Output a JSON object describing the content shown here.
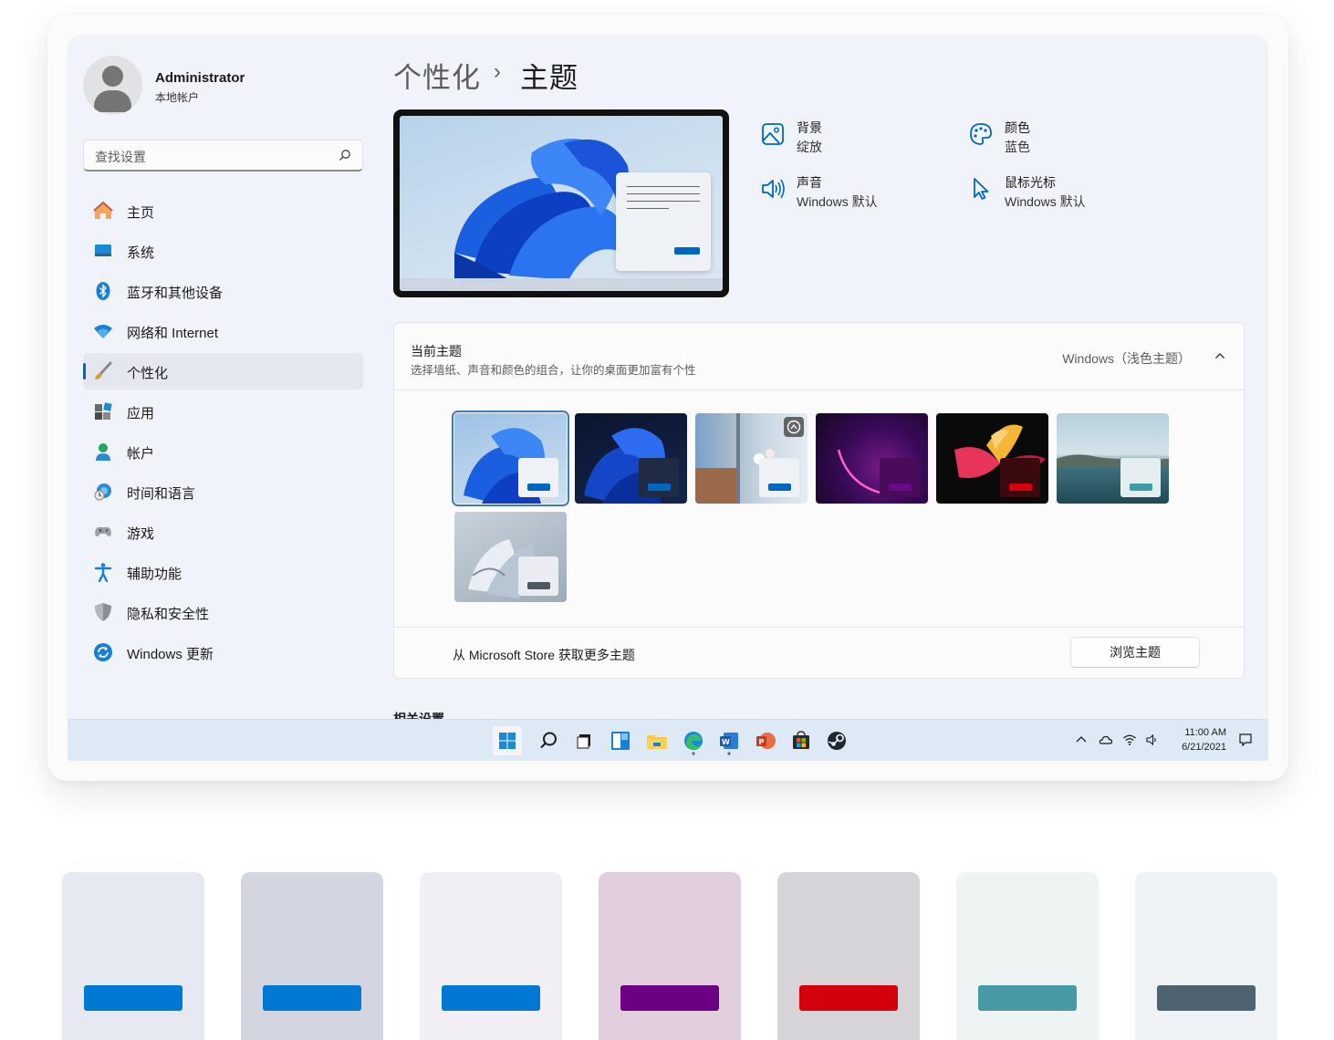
{
  "user": {
    "name": "Administrator",
    "account_type": "本地帐户"
  },
  "search": {
    "placeholder": "查找设置"
  },
  "nav": {
    "items": [
      {
        "label": "主页",
        "icon": "home-icon"
      },
      {
        "label": "系统",
        "icon": "system-icon"
      },
      {
        "label": "蓝牙和其他设备",
        "icon": "bluetooth-icon"
      },
      {
        "label": "网络和 Internet",
        "icon": "wifi-icon"
      },
      {
        "label": "个性化",
        "icon": "brush-icon",
        "active": true
      },
      {
        "label": "应用",
        "icon": "apps-icon"
      },
      {
        "label": "帐户",
        "icon": "account-icon"
      },
      {
        "label": "时间和语言",
        "icon": "time-language-icon"
      },
      {
        "label": "游戏",
        "icon": "gaming-icon"
      },
      {
        "label": "辅助功能",
        "icon": "accessibility-icon"
      },
      {
        "label": "隐私和安全性",
        "icon": "shield-icon"
      },
      {
        "label": "Windows 更新",
        "icon": "update-icon"
      }
    ]
  },
  "breadcrumb": {
    "parent": "个性化",
    "separator": "›",
    "current": "主题"
  },
  "quick_settings": {
    "background": {
      "title": "背景",
      "value": "绽放",
      "icon": "picture-icon"
    },
    "color": {
      "title": "颜色",
      "value": "蓝色",
      "icon": "palette-icon"
    },
    "sound": {
      "title": "声音",
      "value": "Windows 默认",
      "icon": "speaker-icon"
    },
    "cursor": {
      "title": "鼠标光标",
      "value": "Windows 默认",
      "icon": "cursor-icon"
    }
  },
  "current_theme": {
    "title": "当前主题",
    "description": "选择墙纸、声音和颜色的组合，让你的桌面更加富有个性",
    "value": "Windows（浅色主题）",
    "themes": [
      {
        "name": "light-bloom",
        "selected": true,
        "accent": "#0067c0"
      },
      {
        "name": "dark-bloom",
        "selected": false,
        "accent": "#0067c0"
      },
      {
        "name": "spotlight",
        "selected": false,
        "accent": "#0067c0"
      },
      {
        "name": "glow",
        "selected": false,
        "accent": "#6a0a8a"
      },
      {
        "name": "captured-motion",
        "selected": false,
        "accent": "#d40010"
      },
      {
        "name": "sunrise-lake",
        "selected": false,
        "accent": "#3f9aa7"
      },
      {
        "name": "flow",
        "selected": false,
        "accent": "#4a5964"
      }
    ]
  },
  "store": {
    "text": "从 Microsoft Store 获取更多主题",
    "button": "浏览主题"
  },
  "related": {
    "title": "相关设置"
  },
  "taskbar": {
    "apps": [
      "start-icon",
      "search-icon",
      "task-view-icon",
      "widgets-icon",
      "file-explorer-icon",
      "edge-icon",
      "word-icon",
      "powerpoint-icon",
      "store-icon",
      "steam-icon"
    ],
    "time": "11:00 AM",
    "date": "6/21/2021"
  },
  "swatches": [
    {
      "bg": "#e6e9f1",
      "accent": "#0078d4"
    },
    {
      "bg": "#d3d6e1",
      "accent": "#0078d4"
    },
    {
      "bg": "#f1eff4",
      "accent": "#0078d4"
    },
    {
      "bg": "#e2cfdd",
      "accent": "#6b0082"
    },
    {
      "bg": "#d6d4d9",
      "accent": "#d5000e"
    },
    {
      "bg": "#eef3f4",
      "accent": "#459aa6"
    },
    {
      "bg": "#eff2f5",
      "accent": "#4f6270"
    }
  ]
}
